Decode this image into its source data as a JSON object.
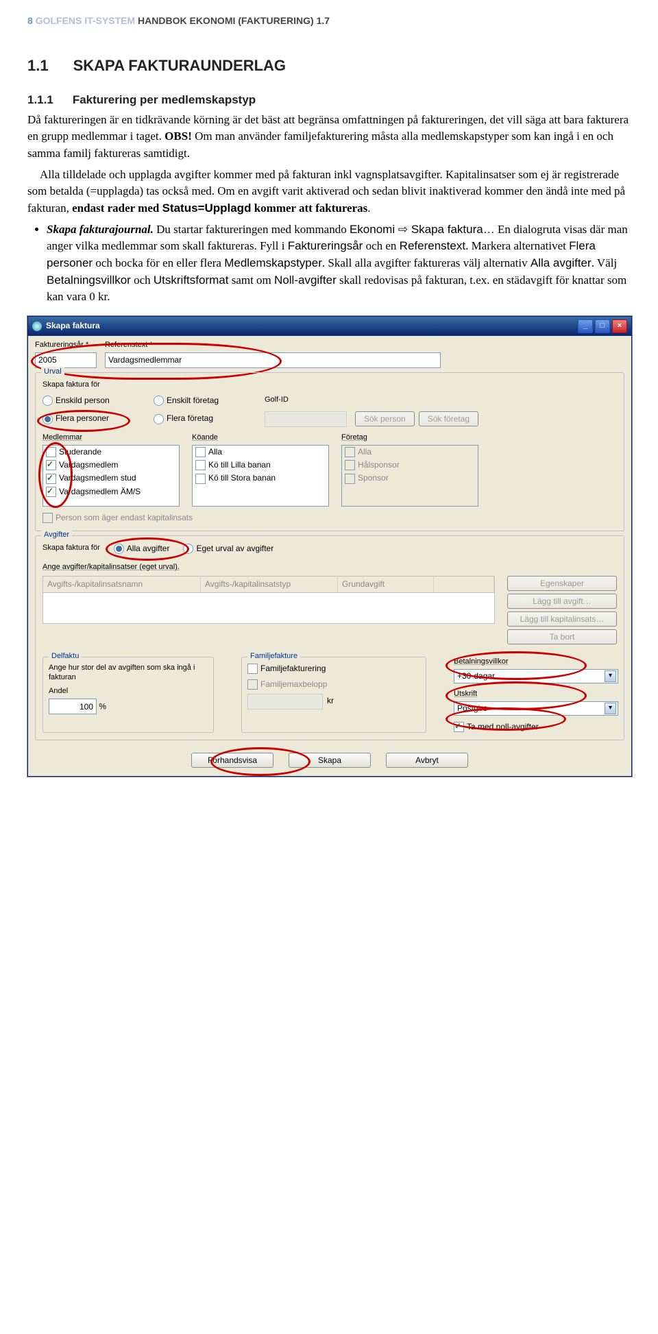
{
  "header": {
    "page_num": "8",
    "system": "GOLFENS IT-SYSTEM",
    "doc_title": "HANDBOK EKONOMI (FAKTURERING) 1.7"
  },
  "h2": {
    "num": "1.1",
    "text": "SKAPA FAKTURAUNDERLAG"
  },
  "h3": {
    "num": "1.1.1",
    "text": "Fakturering per medlemskapstyp"
  },
  "para1": "Då faktureringen är en tidkrävande körning är det bäst att begränsa omfattningen på faktureringen, det vill säga att bara fakturera en grupp medlemmar i taget. ",
  "obs": "OBS!",
  "para1b": " Om man använder familjefakturering måsta alla medlemskapstyper som kan ingå i en och samma familj faktureras samtidigt.",
  "para2a": "Alla tilldelade och upplagda avgifter kommer med på fakturan inkl vagnsplatsavgifter. Kapitalinsatser som ej är registrerade som betalda (=upplagda) tas också med. Om en avgift varit aktiverad och sedan blivit inaktiverad kommer den ändå inte med på fakturan, ",
  "para2_bold_pre": "endast rader med ",
  "para2_sans": "Status=Upplagd",
  "para2_bold_post": " kommer att faktureras",
  "para2_end": ".",
  "bullet_lead_bold": "Skapa fakturajournal.",
  "bullet_lead_text": " Du startar faktureringen med kommando ",
  "bullet_cmd1": "Ekonomi",
  "bullet_arrow": " ⇨ ",
  "bullet_cmd2": "Skapa faktura…",
  "bullet_text2": " En dialogruta visas där man anger vilka medlemmar som skall faktureras. Fyll i ",
  "bullet_f1": "Faktureringsår",
  "bullet_text3": " och en ",
  "bullet_f2": "Referenstext",
  "bullet_text4": ". Markera alternativet ",
  "bullet_f3": "Flera personer",
  "bullet_text5": " och bocka för en eller flera ",
  "bullet_f4": "Medlemskapstyper",
  "bullet_text6": ". Skall alla avgifter faktureras välj alternativ ",
  "bullet_f5": "Alla avgifter",
  "bullet_text7": ". Välj ",
  "bullet_f6": "Betalningsvillkor",
  "bullet_text8": " och ",
  "bullet_f7": "Utskriftsformat",
  "bullet_text9": " samt om ",
  "bullet_f8": "Noll-avgifter",
  "bullet_text10": " skall redovisas på fakturan, t.ex. en städavgift för knattar som kan vara 0 kr.",
  "win": {
    "title": "Skapa faktura",
    "fakt_ar_label": "Faktureringsår *",
    "fakt_ar_value": "2005",
    "ref_label": "Referenstext *",
    "ref_value": "Vardagsmedlemmar",
    "urval_legend": "Urval",
    "skapa_for": "Skapa faktura för",
    "r_enskild_person": "Enskild person",
    "r_enskilt_foretag": "Enskilt företag",
    "r_flera_personer": "Flera personer",
    "r_flera_foretag": "Flera företag",
    "golfid": "Golf-ID",
    "sok_person": "Sök person",
    "sok_foretag": "Sök företag",
    "medlemmar_hdr": "Medlemmar",
    "koande_hdr": "Köande",
    "foretag_hdr": "Företag",
    "mem_items": [
      "Studerande",
      "Vardagsmedlem",
      "Vardagsmedlem stud",
      "Vardagsmedlem ÄM/S"
    ],
    "ko_items": [
      "Alla",
      "Kö till Lilla banan",
      "Kö till Stora banan"
    ],
    "ftg_items": [
      "Alla",
      "Hålsponsor",
      "Sponsor"
    ],
    "kap_chk": "Person som äger endast kapitalinsats",
    "avgifter_legend": "Avgifter",
    "skapa_for2": "Skapa faktura för",
    "r_alla_avg": "Alla avgifter",
    "r_eget_urval": "Eget urval av avgifter",
    "ange_avg": "Ange avgifter/kapitalinsatser (eget urval).",
    "col1": "Avgifts-/kapitalinsatsnamn",
    "col2": "Avgifts-/kapitalinsatstyp",
    "col3": "Grundavgift",
    "btn_egenskaper": "Egenskaper",
    "btn_lagg_avg": "Lägg till avgift…",
    "btn_lagg_kap": "Lägg till kapitalinsats…",
    "btn_tabort": "Ta bort",
    "delfaktu": "Delfaktu",
    "delfaktu_help": "Ange hur stor del av avgiften som ska ingå i fakturan",
    "andel": "Andel",
    "andel_val": "100",
    "pct": "%",
    "famfak": "Familjefakture",
    "famfak_chk": "Familjefakturering",
    "fammax": "Familjemaxbelopp",
    "kr": "kr",
    "betvillkor": "Betalningsvillkor",
    "betvillkor_val": "+30-dagar",
    "utskrift": "Utskrift",
    "utskrift_val": "Postgiro",
    "tamed": "Ta med noll-avgifter",
    "btn_forhands": "Förhandsvisa",
    "btn_skapa": "Skapa",
    "btn_avbryt": "Avbryt"
  }
}
